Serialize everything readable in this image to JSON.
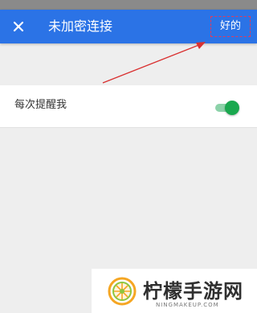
{
  "toolbar": {
    "title": "未加密连接",
    "ok_label": "好的",
    "close_icon": "close-icon",
    "color": "#2b73e6"
  },
  "setting": {
    "label": "每次提醒我",
    "toggle_on": true,
    "toggle_color": "#1aa84f"
  },
  "watermark": {
    "name": "柠檬手游网",
    "url": "NINGMAKEUP.COM"
  }
}
